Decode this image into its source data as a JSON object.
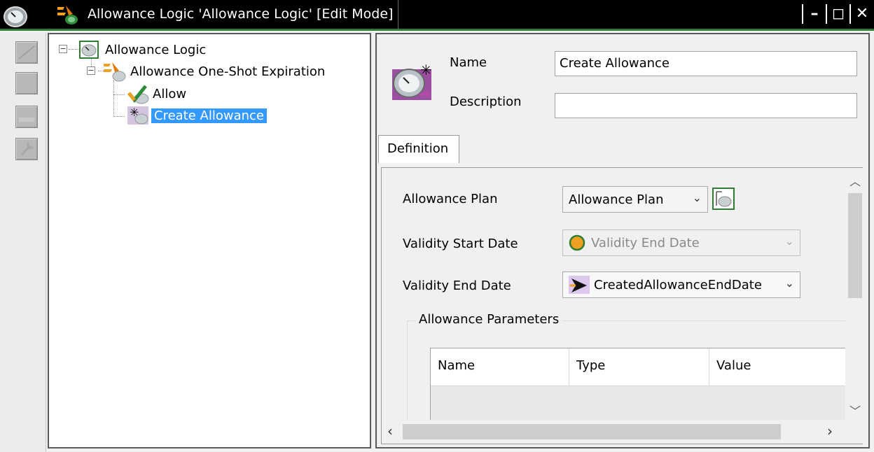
{
  "window": {
    "title": "Allowance Logic 'Allowance Logic' [Edit Mode]",
    "controls": {
      "minimize": "–",
      "restore": "◻",
      "close": "✕"
    }
  },
  "toolbar": {
    "buttons": [
      "toolbar-button-1",
      "toolbar-button-2",
      "toolbar-button-3",
      "toolbar-button-4"
    ]
  },
  "tree": {
    "root": {
      "label": "Allowance Logic",
      "expander": "−"
    },
    "child": {
      "label": "Allowance One-Shot Expiration",
      "expander": "−"
    },
    "leaves": [
      {
        "label": "Allow"
      },
      {
        "label": "Create Allowance",
        "selected": true
      }
    ]
  },
  "form": {
    "name_label": "Name",
    "name_value": "Create Allowance",
    "description_label": "Description",
    "description_value": ""
  },
  "tabs": [
    {
      "label": "Definition",
      "active": true
    }
  ],
  "definition": {
    "allowance_plan_label": "Allowance Plan",
    "allowance_plan_value": "Allowance Plan",
    "validity_start_label": "Validity Start Date",
    "validity_start_value": "Validity End Date",
    "validity_end_label": "Validity End Date",
    "validity_end_value": "CreatedAllowanceEndDate",
    "parameters_group": "Allowance Parameters",
    "grid_columns": [
      "Name",
      "Type",
      "Value"
    ]
  },
  "colors": {
    "titlebar_bg": "#000000",
    "titlebar_accent": "#2e7d32",
    "selection": "#3399ff"
  }
}
